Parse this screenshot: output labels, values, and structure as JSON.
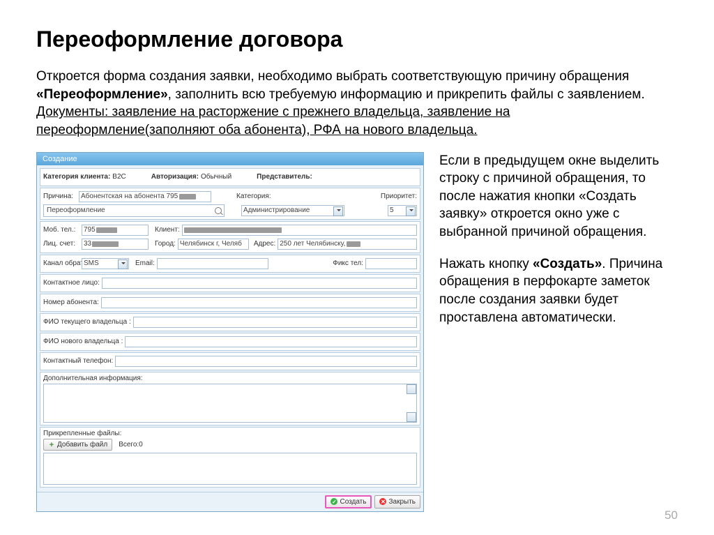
{
  "slide": {
    "title": "Переоформление договора",
    "intro_pre": "Откроется форма создания заявки, необходимо выбрать соответствующую причину обращения ",
    "intro_bold": "«Переоформление»",
    "intro_post": ", заполнить всю требуемую информацию и прикрепить файлы с заявлением.",
    "docs": "Документы: заявление на расторжение с прежнего владельца, заявление на переоформление(заполняют оба абонента), РФА на нового владельца.",
    "side1": "Если в предыдущем окне выделить строку с причиной обращения, то после нажатия кнопки «Создать заявку» откроется окно уже с выбранной причиной обращения.",
    "side2_pre": "Нажать кнопку ",
    "side2_bold": "«Создать»",
    "side2_post": ". Причина обращения в перфокарте заметок после создания заявки будет проставлена автоматически.",
    "page": "50"
  },
  "win": {
    "title": "Создание",
    "hdr_cat_lbl": "Категория клиента:",
    "hdr_cat_val": "B2C",
    "hdr_auth_lbl": "Авторизация:",
    "hdr_auth_val": "Обычный",
    "hdr_rep_lbl": "Представитель:",
    "reason_lbl": "Причина:",
    "reason_val": "Абонентская  на абонента 795",
    "category_lbl": "Категория:",
    "category_val": "Администрирование",
    "priority_lbl": "Приоритет:",
    "priority_val": "5",
    "search_val": "Переоформление",
    "mob_lbl": "Моб. тел.:",
    "mob_val": "795",
    "client_lbl": "Клиент:",
    "acct_lbl": "Лиц. счет:",
    "acct_val": "33",
    "city_lbl": "Город:",
    "city_val": "Челябинск г, Челяб",
    "addr_lbl": "Адрес:",
    "addr_val": "250 лет Челябинску,",
    "channel_lbl": "Канал обратной связи:",
    "channel_val": "SMS",
    "email_lbl": "Email:",
    "fax_lbl": "Фикс тел:",
    "contact_lbl": "Контактное лицо:",
    "subnum_lbl": "Номер абонента:",
    "curown_lbl": "ФИО текущего владельца :",
    "newown_lbl": "ФИО нового владельца :",
    "cphone_lbl": "Контактный телефон:",
    "addinfo_lbl": "Дополнительная информация:",
    "files_lbl": "Прикрепленные файлы:",
    "addfile_btn": "Добавить файл",
    "total_lbl": "Всего:0",
    "create_btn": "Создать",
    "close_btn": "Закрыть"
  }
}
